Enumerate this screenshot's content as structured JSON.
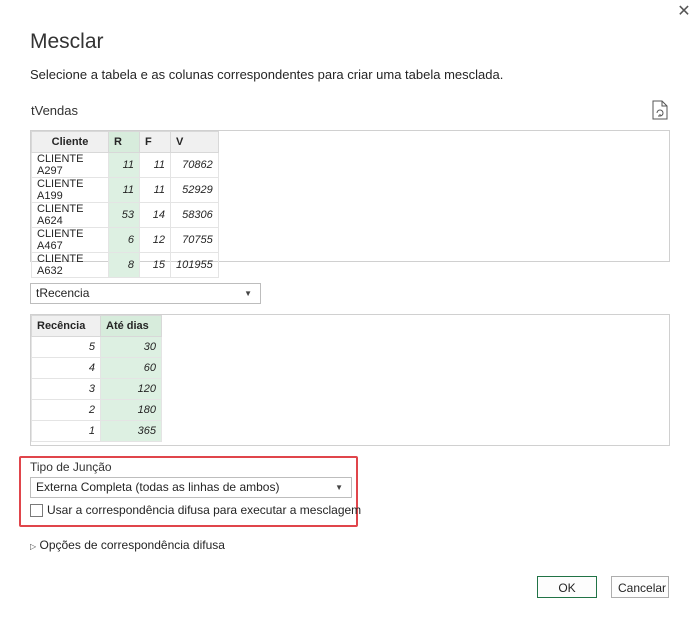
{
  "dialog": {
    "title": "Mesclar",
    "subtitle": "Selecione a tabela e as colunas correspondentes para criar uma tabela mesclada.",
    "close_icon": "close-icon"
  },
  "table1": {
    "name": "tVendas",
    "columns": [
      "Cliente",
      "R",
      "F",
      "V"
    ],
    "rows": [
      [
        "CLIENTE A297",
        "11",
        "11",
        "70862"
      ],
      [
        "CLIENTE A199",
        "11",
        "11",
        "52929"
      ],
      [
        "CLIENTE A624",
        "53",
        "14",
        "58306"
      ],
      [
        "CLIENTE A467",
        "6",
        "12",
        "70755"
      ],
      [
        "CLIENTE A632",
        "8",
        "15",
        "101955"
      ]
    ]
  },
  "table2": {
    "selected": "tRecencia",
    "columns": [
      "Recência",
      "Até dias"
    ],
    "rows": [
      [
        "5",
        "30"
      ],
      [
        "4",
        "60"
      ],
      [
        "3",
        "120"
      ],
      [
        "2",
        "180"
      ],
      [
        "1",
        "365"
      ]
    ]
  },
  "join": {
    "label": "Tipo de Junção",
    "selected": "Externa Completa (todas as linhas de ambos)",
    "fuzzy_checkbox_label": "Usar a correspondência difusa para executar a mesclagem",
    "fuzzy_checked": false
  },
  "fuzzy_options_label": "Opções de correspondência difusa",
  "buttons": {
    "ok": "OK",
    "cancel": "Cancelar"
  },
  "colors": {
    "selected_column": "#ddf0e2",
    "highlight_border": "#e0454b",
    "ok_border": "#217346"
  }
}
